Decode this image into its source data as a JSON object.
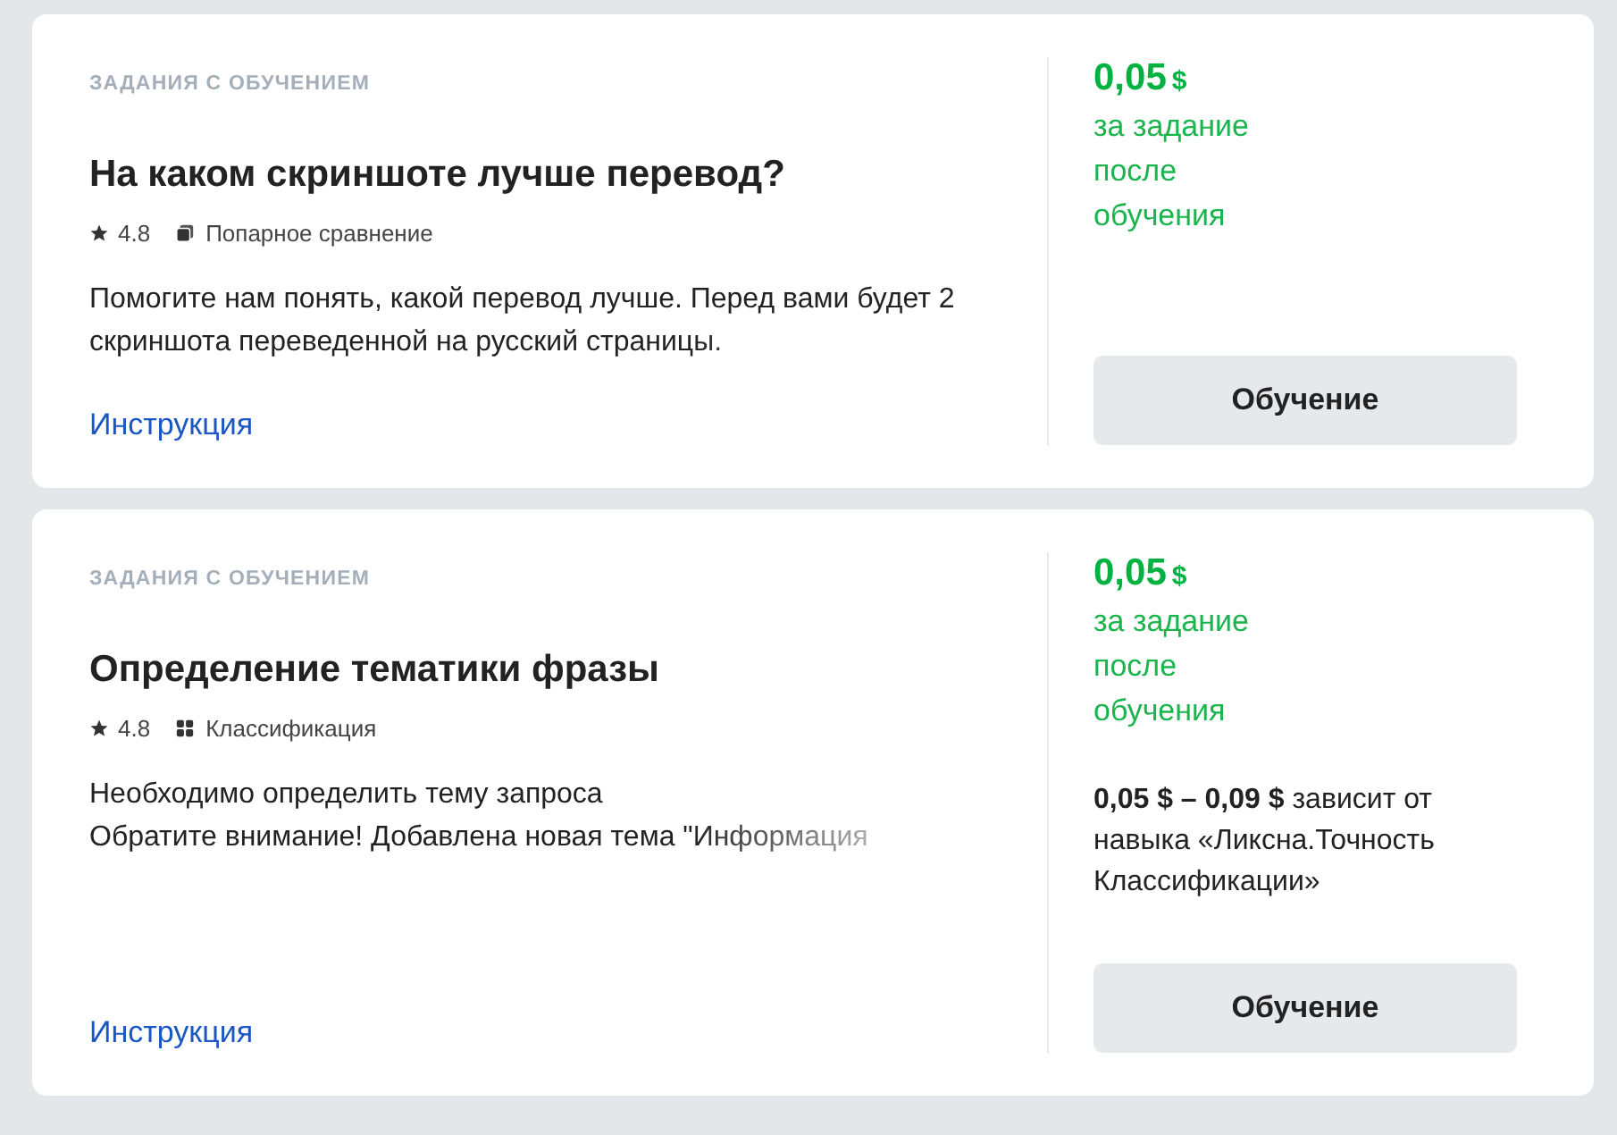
{
  "tasks": [
    {
      "category": "ЗАДАНИЯ С ОБУЧЕНИЕМ",
      "title": "На каком скриншоте лучше перевод?",
      "rating": "4.8",
      "type": {
        "kind": "pairwise",
        "label": "Попарное сравнение"
      },
      "description": "Помогите нам понять, какой перевод лучше.  Перед вами будет 2 скриншота переведенной на русский страницы.",
      "link": "Инструкция",
      "price": {
        "amount": "0,05",
        "currency": "$",
        "note": "за задание\nпосле\nобучения"
      },
      "button": "Обучение"
    },
    {
      "category": "ЗАДАНИЯ С ОБУЧЕНИЕМ",
      "title": "Определение тематики фразы",
      "rating": "4.8",
      "type": {
        "kind": "grid",
        "label": "Классификация"
      },
      "description": "Необходимо определить тему запроса\nОбратите внимание! Добавлена новая тема \"Информация",
      "link": "Инструкция",
      "price": {
        "amount": "0,05",
        "currency": "$",
        "note": "за задание\nпосле\nобучения"
      },
      "range_note": "**0,05 $ – 0,09 $** зависит от навыка «Ликсна.Точность Классификации»",
      "button": "Обучение"
    }
  ]
}
